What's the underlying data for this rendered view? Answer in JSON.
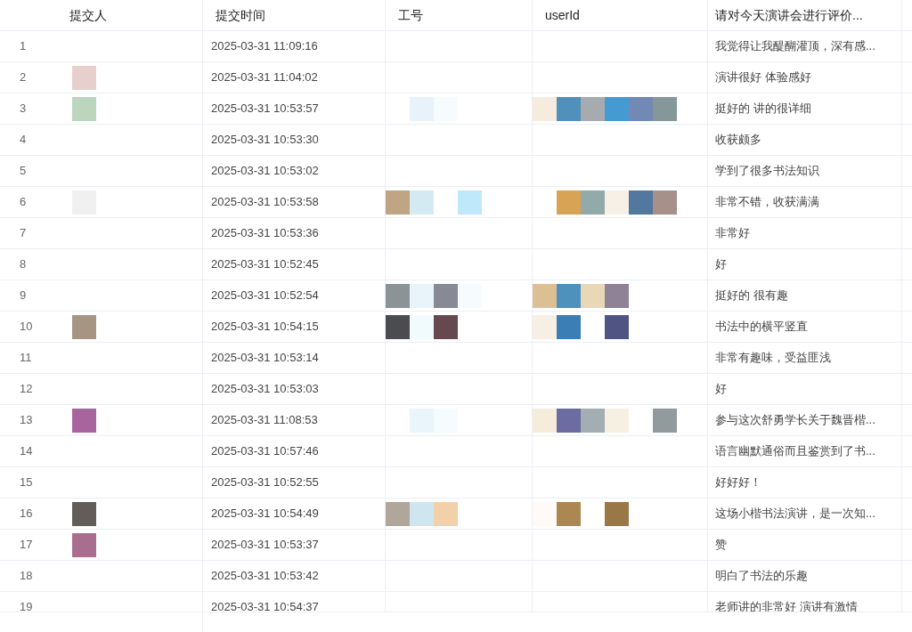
{
  "columns": [
    "提交人",
    "提交时间",
    "工号",
    "userId",
    "请对今天演讲会进行评价..."
  ],
  "rows": [
    {
      "index": "1",
      "time": "2025-03-31 11:09:16",
      "comment": "我觉得让我醍醐灌顶，深有感..."
    },
    {
      "index": "2",
      "time": "2025-03-31 11:04:02",
      "comment": "演讲很好 体验感好"
    },
    {
      "index": "3",
      "time": "2025-03-31 10:53:57",
      "comment": "挺好的 讲的很详细"
    },
    {
      "index": "4",
      "time": "2025-03-31 10:53:30",
      "comment": "收获颇多"
    },
    {
      "index": "5",
      "time": "2025-03-31 10:53:02",
      "comment": "学到了很多书法知识"
    },
    {
      "index": "6",
      "time": "2025-03-31 10:53:58",
      "comment": "非常不错，收获满满"
    },
    {
      "index": "7",
      "time": "2025-03-31 10:53:36",
      "comment": "非常好"
    },
    {
      "index": "8",
      "time": "2025-03-31 10:52:45",
      "comment": "好"
    },
    {
      "index": "9",
      "time": "2025-03-31 10:52:54",
      "comment": "挺好的 很有趣"
    },
    {
      "index": "10",
      "time": "2025-03-31 10:54:15",
      "comment": "书法中的横平竖直"
    },
    {
      "index": "11",
      "time": "2025-03-31 10:53:14",
      "comment": "非常有趣味，受益匪浅"
    },
    {
      "index": "12",
      "time": "2025-03-31 10:53:03",
      "comment": "好"
    },
    {
      "index": "13",
      "time": "2025-03-31 11:08:53",
      "comment": "参与这次舒勇学长关于魏晋楷..."
    },
    {
      "index": "14",
      "time": "2025-03-31 10:57:46",
      "comment": "语言幽默通俗而且鉴赏到了书..."
    },
    {
      "index": "15",
      "time": "2025-03-31 10:52:55",
      "comment": "好好好！"
    },
    {
      "index": "16",
      "time": "2025-03-31 10:54:49",
      "comment": "这场小楷书法演讲，是一次知..."
    },
    {
      "index": "17",
      "time": "2025-03-31 10:53:37",
      "comment": "赞"
    },
    {
      "index": "18",
      "time": "2025-03-31 10:53:42",
      "comment": "明白了书法的乐趣"
    },
    {
      "index": "19",
      "time": "2025-03-31 10:54:37",
      "comment": "老师讲的非常好 演讲有激情"
    }
  ]
}
